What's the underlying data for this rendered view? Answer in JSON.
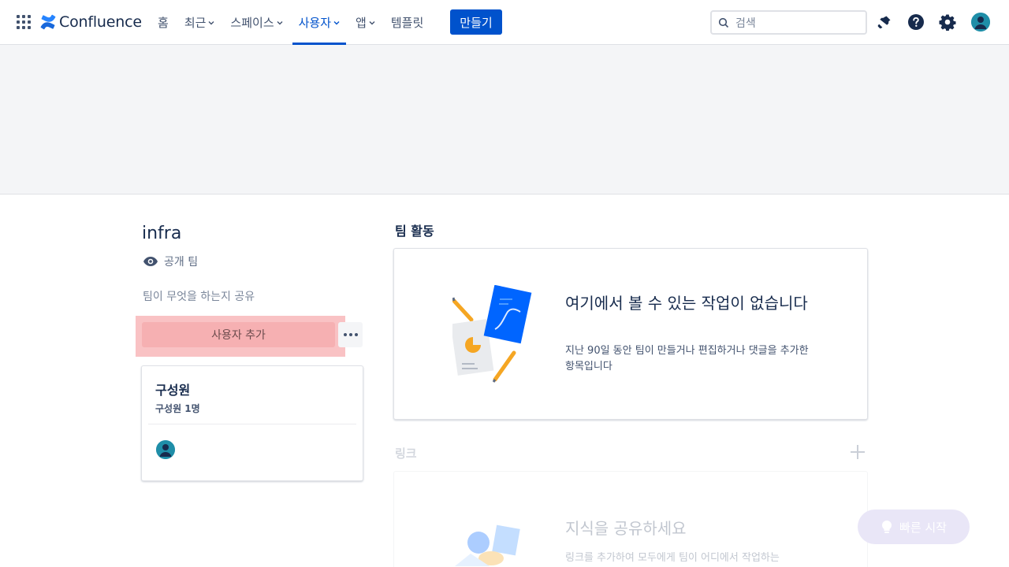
{
  "topnav": {
    "logo_text": "Confluence",
    "items": [
      {
        "label": "홈",
        "dropdown": false,
        "active": false
      },
      {
        "label": "최근",
        "dropdown": true,
        "active": false
      },
      {
        "label": "스페이스",
        "dropdown": true,
        "active": false
      },
      {
        "label": "사용자",
        "dropdown": true,
        "active": true
      },
      {
        "label": "앱",
        "dropdown": true,
        "active": false
      },
      {
        "label": "템플릿",
        "dropdown": false,
        "active": false
      }
    ],
    "create_label": "만들기",
    "search_placeholder": "검색",
    "icons": [
      "notification-icon",
      "help-icon",
      "settings-icon",
      "profile-avatar"
    ]
  },
  "team": {
    "name": "infra",
    "visibility": "공개 팀",
    "description_placeholder": "팀이 무엇을 하는지 공유",
    "add_user_label": "사용자 추가"
  },
  "members": {
    "title": "구성원",
    "count_text": "구성원 1명"
  },
  "activity": {
    "title": "팀 활동",
    "empty_title": "여기에서 볼 수 있는 작업이 없습니다",
    "empty_desc": "지난 90일 동안 팀이 만들거나 편집하거나 댓글을 추가한 항목입니다"
  },
  "links": {
    "title": "링크",
    "empty_title": "지식을 공유하세요",
    "empty_desc": "링크를 추가하여 모두에게 팀이 어디에서 작업하는"
  },
  "quickstart_label": "빠른 시작",
  "colors": {
    "brand": "#0052cc",
    "highlight": "#f6b0b2",
    "text_primary": "#172b4d"
  }
}
